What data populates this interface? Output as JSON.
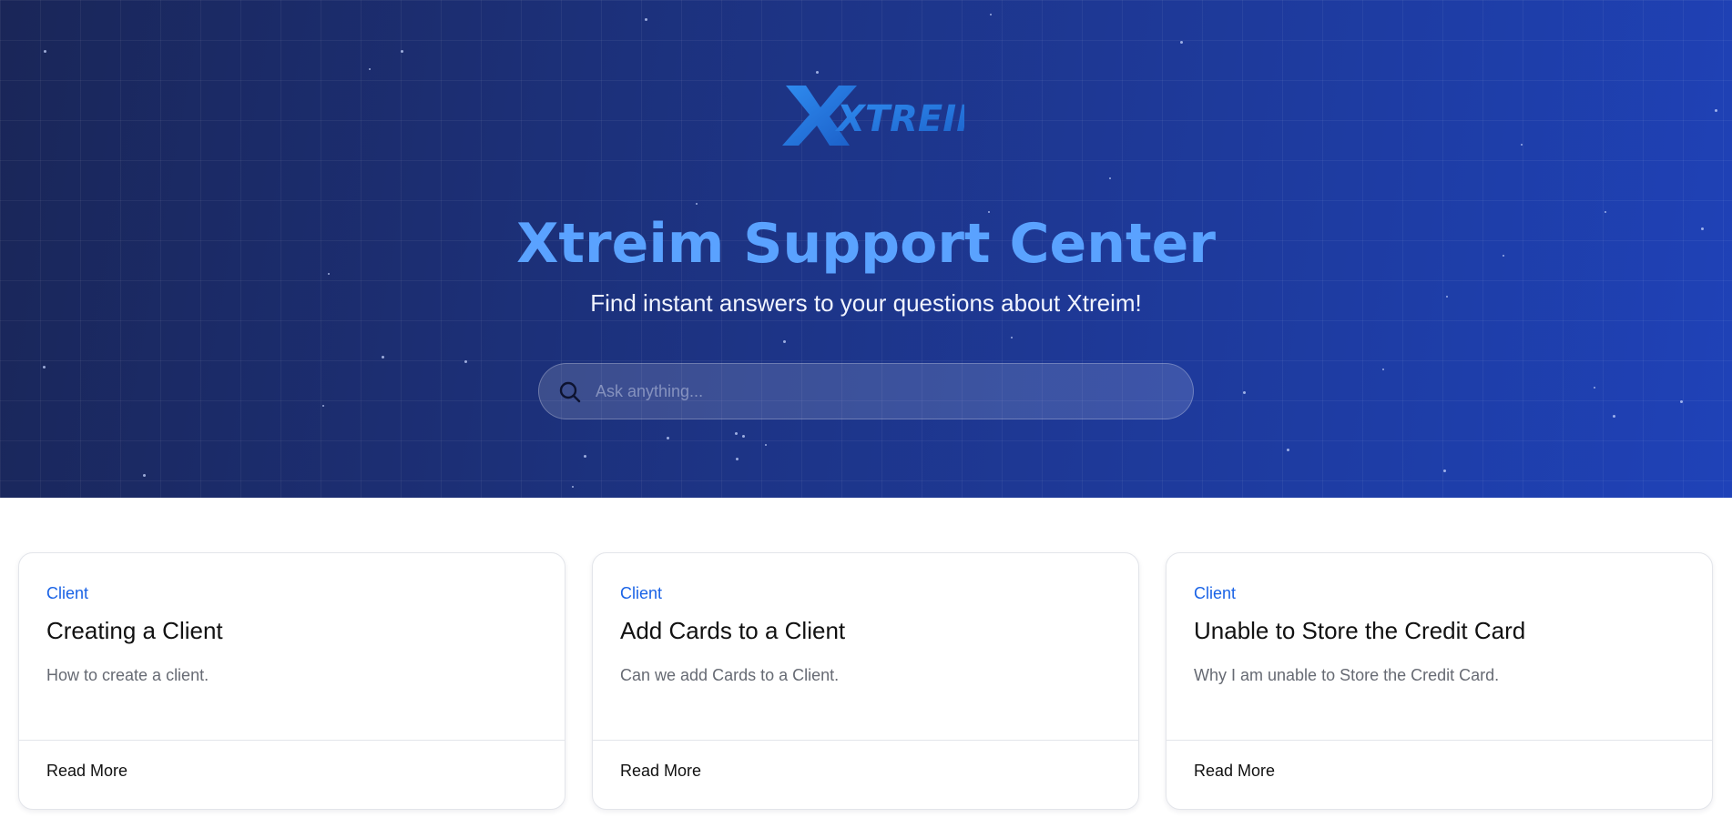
{
  "logo": {
    "text": "XTREIM"
  },
  "hero": {
    "title": "Xtreim Support Center",
    "subtitle": "Find instant answers to your questions about Xtreim!"
  },
  "search": {
    "placeholder": "Ask anything...",
    "value": ""
  },
  "cards": [
    {
      "category": "Client",
      "title": "Creating a Client",
      "description": "How to create a client.",
      "link_label": "Read More"
    },
    {
      "category": "Client",
      "title": "Add Cards to a Client",
      "description": "Can we add Cards to a Client.",
      "link_label": "Read More"
    },
    {
      "category": "Client",
      "title": "Unable to Store the Credit Card",
      "description": "Why I am unable to Store the Credit Card.",
      "link_label": "Read More"
    }
  ],
  "colors": {
    "accent": "#1a63e6",
    "title": "#5aa2ff",
    "hero_start": "#1a2658",
    "hero_end": "#1f42b8"
  }
}
